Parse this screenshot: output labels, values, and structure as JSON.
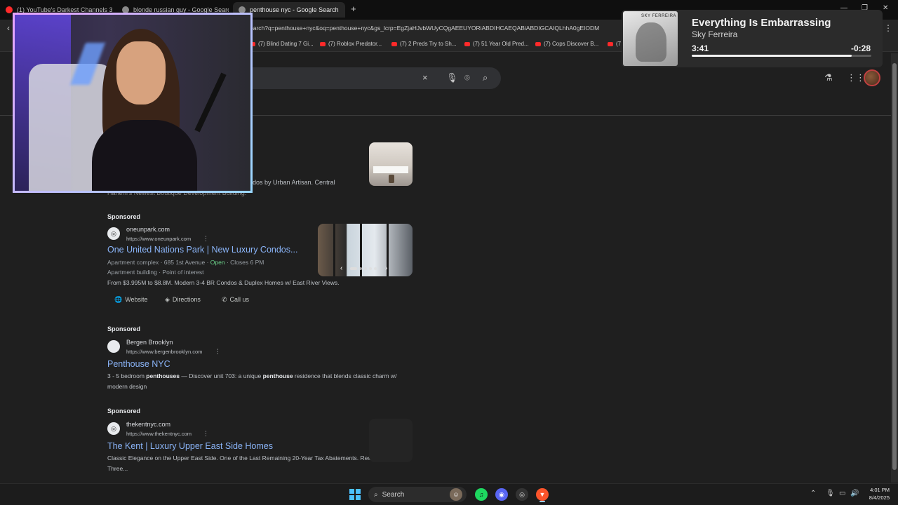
{
  "browser": {
    "tabs": [
      {
        "label": "(1) YouTube's Darkest Channels 3 - Y",
        "favicon_color": "#ff2a2a"
      },
      {
        "label": "blonde russian guy - Google Search",
        "favicon_color": "#8a8a8a"
      },
      {
        "label": "penthouse nyc - Google Search",
        "favicon_color": "#8a8a8a",
        "active": true
      }
    ],
    "new_tab": "+",
    "url": "earch?q=penthouse+nyc&oq=penthouse+nyc&gs_lcrp=EgZjaHJvbWUyCQgAEEUYORiABDIHCAEQABiABDIGCAIQLhhA0gEIODM",
    "bookmarks": [
      "(7) Blind Dating 7 Gi...",
      "(7) Roblox Predator...",
      "(7) 2 Preds Try to Sh...",
      "(7) 51 Year Old Pred...",
      "(7) Cops Discover B...",
      "(7"
    ]
  },
  "search": {
    "query": "",
    "clear_icon": "×"
  },
  "music": {
    "album_label": "SKY FERREIRA",
    "title": "Everything Is Embarrassing",
    "artist": "Sky Ferreira",
    "elapsed": "3:41",
    "remaining": "-0:28",
    "progress": 0.89
  },
  "results": {
    "partial_snippet": "ondos by Urban Artisan. Central",
    "partial_snippet2": "Harlem's Newest Boutique Development Building.",
    "ads": [
      {
        "sponsored": "Sponsored",
        "favicon": "◎",
        "site": "oneunpark.com",
        "url": "https://www.oneunpark.com",
        "title": "One United Nations Park | New Luxury Condos...",
        "meta1_prefix": "Apartment complex · 685 1st Avenue · ",
        "meta1_open": "Open",
        "meta1_suffix": " · Closes 6 PM",
        "meta2": "Apartment building · Point of interest",
        "desc": "From $3.995M to $8.8M. Modern 3-4 BR Condos & Duplex Homes w/ East River Views.",
        "chips": [
          "Website",
          "Directions",
          "Call us"
        ]
      },
      {
        "sponsored": "Sponsored",
        "favicon": "",
        "site": "Bergen Brooklyn",
        "url": "https://www.bergenbrooklyn.com",
        "title": "Penthouse NYC",
        "desc_parts": [
          "3 - 5 bedroom ",
          "penthouses",
          " — Discover unit 703: a unique ",
          "penthouse",
          " residence that blends classic charm w/ modern design"
        ]
      },
      {
        "sponsored": "Sponsored",
        "favicon": "◎",
        "site": "thekentnyc.com",
        "url": "https://www.thekentnyc.com",
        "title": "The Kent | Luxury Upper East Side Homes",
        "desc": "Classic Elegance on the Upper East Side. One of the Last Remaining 20-Year Tax Abatements. Residences Offer Three..."
      }
    ]
  },
  "taskbar": {
    "search_label": "Search",
    "time": "4:01 PM",
    "date": "8/4/2025"
  }
}
